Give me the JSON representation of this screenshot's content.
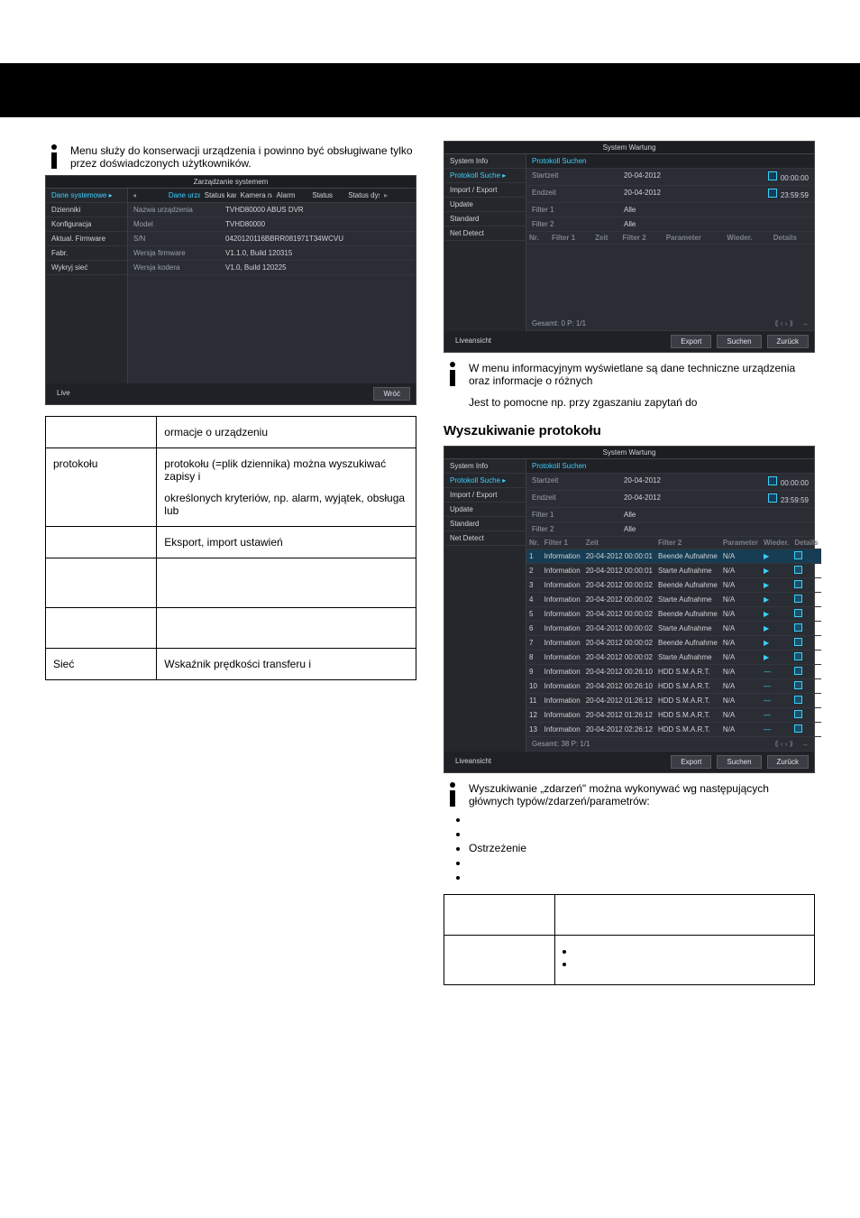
{
  "intro_left": "Menu służy do konserwacji urządzenia i powinno być obsługiwane tylko przez doświadczonych użytkowników.",
  "intro_right_a": "W menu informacyjnym wyświetlane są dane techniczne urządzenia oraz informacje o różnych",
  "intro_right_b": "Jest to pomocne np. przy zgaszaniu zapytań do",
  "section_search": "Wyszukiwanie protokołu",
  "intro_search": "Wyszukiwanie „zdarzeń\" można wykonywać wg następujących głównych typów/zdarzeń/parametrów:",
  "bullets": [
    "",
    "",
    "Ostrzeżenie",
    "",
    ""
  ],
  "table_left": {
    "r1c2": "ormacje o urządzeniu",
    "r2c1": "protokołu",
    "r2c2a": "protokołu (=plik dziennika) można wyszukiwać zapisy i",
    "r2c2b": "określonych kryteriów, np. alarm, wyjątek, obsługa lub",
    "r3c2": "Eksport, import ustawień",
    "r6c1": "Sieć",
    "r6c2": "Wskaźnik prędkości transferu i"
  },
  "param_table": {
    "r1": [
      "",
      ""
    ],
    "r2": [
      "",
      ""
    ],
    "r3": [
      "",
      ""
    ]
  },
  "shot1": {
    "title": "Zarządzanie systemem",
    "side": [
      "Dane systemowe",
      "Dzienniki",
      "Konfiguracja",
      "Aktual. Firmware",
      "Fabr.",
      "Wykryj sieć"
    ],
    "side_active": 0,
    "toprow": [
      "Dane urządzenia",
      "Status kanału",
      "Kamera nagrywana",
      "Alarm",
      "Status",
      "Status dysku"
    ],
    "toprow_hl": 0,
    "kv": [
      [
        "Nazwa urządzenia",
        "TVHD80000 ABUS DVR"
      ],
      [
        "Model",
        "TVHD80000"
      ],
      [
        "S/N",
        "0420120116BBRR081971T34WCVU"
      ],
      [
        "Wersja firmware",
        "V1.1.0, Build 120315"
      ],
      [
        "Wersja kodera",
        "V1.0, Build 120225"
      ]
    ],
    "foot_live": "Live",
    "foot_back": "Wróć"
  },
  "shot2": {
    "title": "System Wartung",
    "side": [
      "System Info",
      "Protokoll Suche",
      "Import / Export",
      "Update",
      "Standard",
      "Net Detect"
    ],
    "side_active": 1,
    "rows": [
      [
        "Startzeit",
        "20-04-2012",
        "00:00:00"
      ],
      [
        "Endzeit",
        "20-04-2012",
        "23:59:59"
      ],
      [
        "Filter 1",
        "Alle",
        ""
      ],
      [
        "Filter 2",
        "Alle",
        ""
      ]
    ],
    "head": [
      "Nr.",
      "Filter 1",
      "Zeit",
      "Filter 2",
      "Parameter",
      "Wieder.",
      "Details"
    ],
    "summary": "Gesamt: 0 P: 1/1",
    "foot": [
      "Liveansicht",
      "Export",
      "Suchen",
      "Zurück"
    ]
  },
  "shot3": {
    "title": "System Wartung",
    "side": [
      "System Info",
      "Protokoll Suche",
      "Import / Export",
      "Update",
      "Standard",
      "Net Detect"
    ],
    "side_active": 1,
    "rows": [
      [
        "Startzeit",
        "20-04-2012",
        "00:00:00"
      ],
      [
        "Endzeit",
        "20-04-2012",
        "23:59:59"
      ],
      [
        "Filter 1",
        "Alle",
        ""
      ],
      [
        "Filter 2",
        "Alle",
        ""
      ]
    ],
    "head": [
      "Nr.",
      "Filter 1",
      "Zeit",
      "Filter 2",
      "Parameter",
      "Wieder.",
      "Details"
    ],
    "events": [
      [
        "1",
        "Information",
        "20-04-2012 00:00:01",
        "Beende Aufnahme",
        "N/A"
      ],
      [
        "2",
        "Information",
        "20-04-2012 00:00:01",
        "Starte Aufnahme",
        "N/A"
      ],
      [
        "3",
        "Information",
        "20-04-2012 00:00:02",
        "Beende Aufnahme",
        "N/A"
      ],
      [
        "4",
        "Information",
        "20-04-2012 00:00:02",
        "Starte Aufnahme",
        "N/A"
      ],
      [
        "5",
        "Information",
        "20-04-2012 00:00:02",
        "Beende Aufnahme",
        "N/A"
      ],
      [
        "6",
        "Information",
        "20-04-2012 00:00:02",
        "Starte Aufnahme",
        "N/A"
      ],
      [
        "7",
        "Information",
        "20-04-2012 00:00:02",
        "Beende Aufnahme",
        "N/A"
      ],
      [
        "8",
        "Information",
        "20-04-2012 00:00:02",
        "Starte Aufnahme",
        "N/A"
      ],
      [
        "9",
        "Information",
        "20-04-2012 00:26:10",
        "HDD S.M.A.R.T.",
        "N/A"
      ],
      [
        "10",
        "Information",
        "20-04-2012 00:26:10",
        "HDD S.M.A.R.T.",
        "N/A"
      ],
      [
        "11",
        "Information",
        "20-04-2012 01:26:12",
        "HDD S.M.A.R.T.",
        "N/A"
      ],
      [
        "12",
        "Information",
        "20-04-2012 01:26:12",
        "HDD S.M.A.R.T.",
        "N/A"
      ],
      [
        "13",
        "Information",
        "20-04-2012 02:26:12",
        "HDD S.M.A.R.T.",
        "N/A"
      ]
    ],
    "summary": "Gesamt: 38 P: 1/1",
    "foot": [
      "Liveansicht",
      "Export",
      "Suchen",
      "Zurück"
    ]
  }
}
